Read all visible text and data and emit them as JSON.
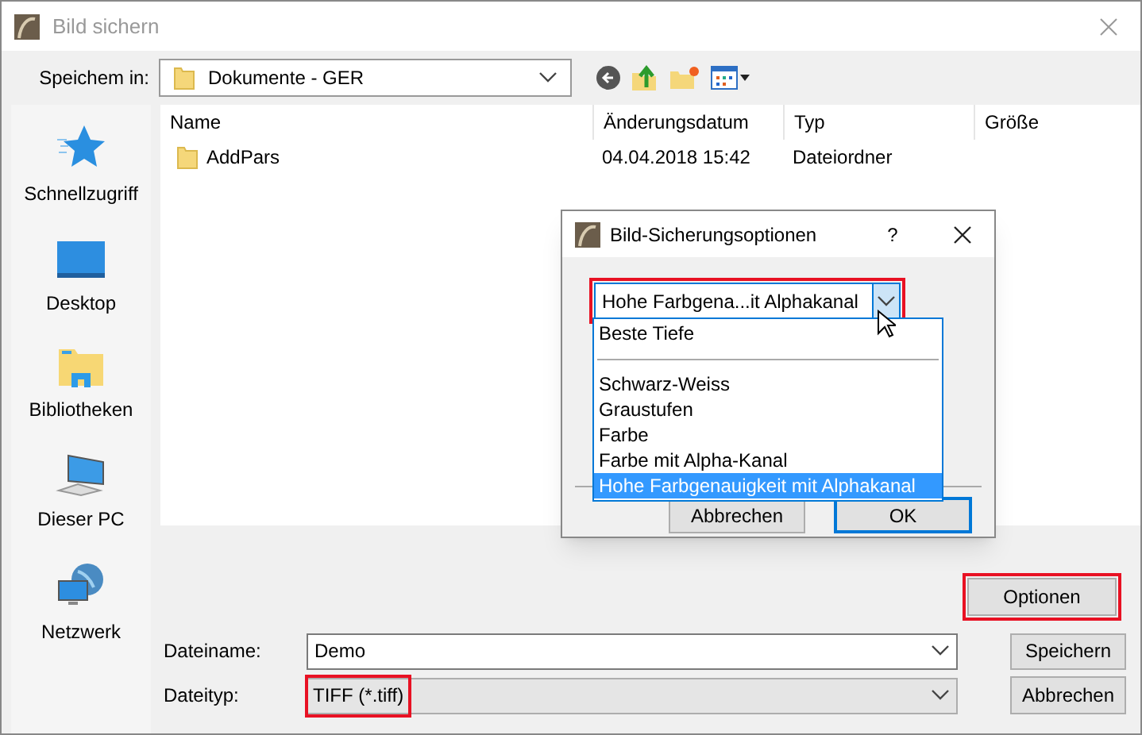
{
  "window": {
    "title": "Bild sichern"
  },
  "location": {
    "label": "Speichem in:",
    "value": "Dokumente - GER"
  },
  "sidebar": {
    "items": [
      {
        "label": "Schnellzugriff",
        "kind": "star"
      },
      {
        "label": "Desktop",
        "kind": "desktop"
      },
      {
        "label": "Bibliotheken",
        "kind": "library"
      },
      {
        "label": "Dieser PC",
        "kind": "pc"
      },
      {
        "label": "Netzwerk",
        "kind": "network"
      }
    ]
  },
  "table": {
    "columns": [
      "Name",
      "Änderungsdatum",
      "Typ",
      "Größe"
    ],
    "rows": [
      {
        "name": "AddPars",
        "date": "04.04.2018 15:42",
        "type": "Dateiordner"
      }
    ]
  },
  "options_button": {
    "label": "Optionen",
    "highlighted": true
  },
  "filename": {
    "label": "Dateiname:",
    "value": "Demo"
  },
  "filetype": {
    "label": "Dateityp:",
    "value": "TIFF (*.tiff)",
    "highlighted": true
  },
  "buttons": [
    "Speichern",
    "Abbrechen"
  ],
  "dialog": {
    "title": "Bild-Sicherungsoptionen",
    "help": "?",
    "combo": {
      "value": "Hohe Farbgena...it Alphakanal",
      "highlighted": true
    },
    "options": [
      {
        "kind": "option",
        "label": "Beste Tiefe",
        "selected": false
      },
      {
        "kind": "separator"
      },
      {
        "kind": "option",
        "label": "Schwarz-Weiss",
        "selected": false
      },
      {
        "kind": "option",
        "label": "Graustufen",
        "selected": false
      },
      {
        "kind": "option",
        "label": "Farbe",
        "selected": false
      },
      {
        "kind": "option",
        "label": "Farbe mit Alpha-Kanal",
        "selected": false
      },
      {
        "kind": "option",
        "label": "Hohe Farbgenauigkeit mit Alphakanal",
        "selected": true
      }
    ],
    "buttons": [
      "Abbrechen",
      "OK"
    ]
  }
}
